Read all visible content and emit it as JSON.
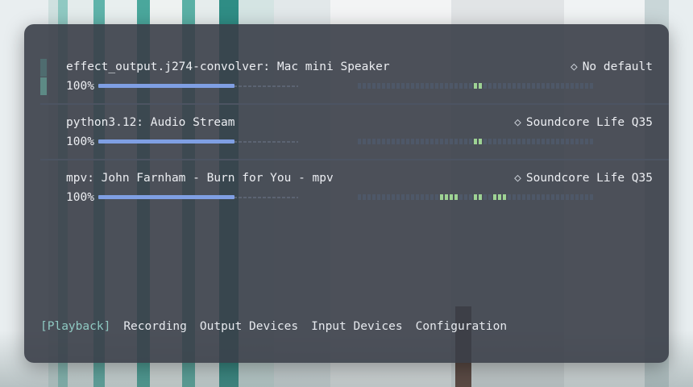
{
  "streams": [
    {
      "name": "effect_output.j274-convolver: Mac mini Speaker",
      "device": "No default",
      "volume_label": "100%",
      "volume_fraction": 0.68,
      "selected": true,
      "meter_on": [
        24,
        25
      ]
    },
    {
      "name": "python3.12: Audio Stream",
      "device": "Soundcore Life Q35",
      "volume_label": "100%",
      "volume_fraction": 0.68,
      "selected": false,
      "meter_on": [
        24,
        25
      ]
    },
    {
      "name": "mpv: John Farnham - Burn for You - mpv",
      "device": "Soundcore Life Q35",
      "volume_label": "100%",
      "volume_fraction": 0.68,
      "selected": false,
      "meter_on": [
        17,
        18,
        19,
        20,
        24,
        25,
        28,
        29,
        30
      ]
    }
  ],
  "meter_segments": 49,
  "device_icon": "diamond-outline-icon",
  "tabs": [
    {
      "label": "[Playback]",
      "active": true
    },
    {
      "label": "Recording",
      "active": false
    },
    {
      "label": "Output Devices",
      "active": false
    },
    {
      "label": "Input Devices",
      "active": false
    },
    {
      "label": "Configuration",
      "active": false
    }
  ],
  "colors": {
    "accent": "#8fc9c2",
    "volume_fill": "#7f9fe3",
    "meter_on": "#9ed394",
    "meter_off": "#4e5868",
    "window_bg": "#3a3e48"
  }
}
